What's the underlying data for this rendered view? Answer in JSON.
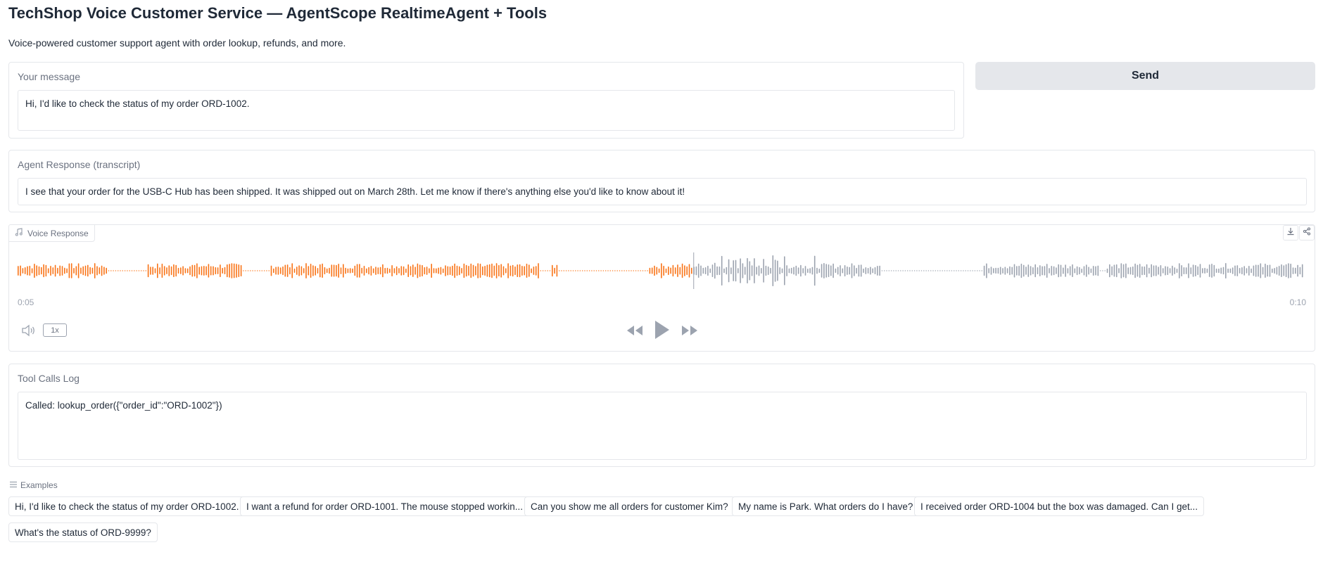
{
  "header": {
    "title": "TechShop Voice Customer Service — AgentScope RealtimeAgent + Tools",
    "subtitle": "Voice-powered customer support agent with order lookup, refunds, and more."
  },
  "message": {
    "label": "Your message",
    "value": "Hi, I'd like to check the status of my order ORD-1002."
  },
  "send_label": "Send",
  "agent_response": {
    "label": "Agent Response (transcript)",
    "value": "I see that your order for the USB-C Hub has been shipped. It was shipped out on March 28th. Let me know if there's anything else you'd like to know about it!"
  },
  "voice": {
    "label": "Voice Response",
    "current_time": "0:05",
    "duration": "0:10",
    "progress": 0.525,
    "playback_rate": "1x",
    "played_color": "#f97316",
    "unplayed_color": "#9ca3af",
    "icons": [
      "music-note-icon",
      "download-icon",
      "share-icon",
      "volume-icon",
      "rewind-icon",
      "play-icon",
      "fast-forward-icon"
    ]
  },
  "tool_calls": {
    "label": "Tool Calls Log",
    "value": "Called: lookup_order({\"order_id\":\"ORD-1002\"})"
  },
  "examples": {
    "label": "Examples",
    "items": [
      "Hi, I'd like to check the status of my order ORD-1002.",
      "I want a refund for order ORD-1001. The mouse stopped workin...",
      "Can you show me all orders for customer Kim?",
      "My name is Park. What orders do I have?",
      "I received order ORD-1004 but the box was damaged. Can I get...",
      "What's the status of ORD-9999?"
    ]
  }
}
